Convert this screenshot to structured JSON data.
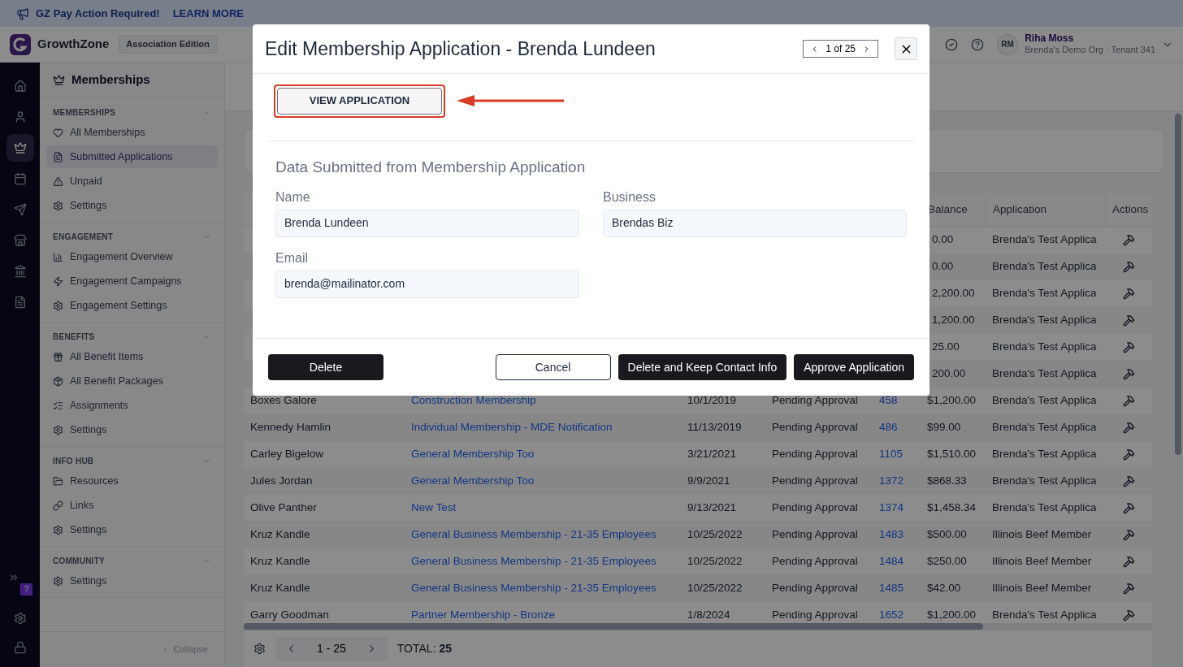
{
  "banner": {
    "message": "GZ Pay Action Required!",
    "link": "LEARN MORE"
  },
  "topbar": {
    "brand": "GrowthZone",
    "edition": "Association Edition",
    "user": {
      "initials": "RM",
      "name": "Riha Moss",
      "org": "Brenda's Demo Org · Tenant 341"
    }
  },
  "rail": {
    "items": [
      {
        "selected": false
      },
      {
        "selected": false
      },
      {
        "selected": true
      },
      {
        "selected": false
      },
      {
        "selected": false
      },
      {
        "selected": false
      },
      {
        "selected": false
      },
      {
        "selected": false
      }
    ],
    "help_badge": "?"
  },
  "sidebar": {
    "title": "Memberships",
    "sections": [
      {
        "heading": "MEMBERSHIPS",
        "items": [
          {
            "label": "All Memberships",
            "selected": false
          },
          {
            "label": "Submitted Applications",
            "selected": true
          },
          {
            "label": "Unpaid",
            "selected": false
          },
          {
            "label": "Settings",
            "selected": false
          }
        ]
      },
      {
        "heading": "ENGAGEMENT",
        "items": [
          {
            "label": "Engagement Overview",
            "selected": false
          },
          {
            "label": "Engagement Campaigns",
            "selected": false
          },
          {
            "label": "Engagement Settings",
            "selected": false
          }
        ]
      },
      {
        "heading": "BENEFITS",
        "items": [
          {
            "label": "All Benefit Items",
            "selected": false
          },
          {
            "label": "All Benefit Packages",
            "selected": false
          },
          {
            "label": "Assignments",
            "selected": false
          },
          {
            "label": "Settings",
            "selected": false
          }
        ]
      },
      {
        "heading": "INFO HUB",
        "items": [
          {
            "label": "Resources",
            "selected": false
          },
          {
            "label": "Links",
            "selected": false
          },
          {
            "label": "Settings",
            "selected": false
          }
        ]
      },
      {
        "heading": "COMMUNITY",
        "items": [
          {
            "label": "Settings",
            "selected": false
          }
        ]
      }
    ],
    "collapse": "Collapse"
  },
  "table": {
    "columns": [
      {
        "label": "Balance"
      },
      {
        "label": "Application"
      },
      {
        "label": "Actions"
      }
    ],
    "rows": [
      {
        "kind": "partial",
        "balance": "0.00",
        "application": "Brenda's Test Applica"
      },
      {
        "kind": "partial",
        "balance": "0.00",
        "application": "Brenda's Test Applica"
      },
      {
        "kind": "partial",
        "balance": "2,200.00",
        "application": "Brenda's Test Applica"
      },
      {
        "kind": "partial",
        "balance": "1,200.00",
        "application": "Brenda's Test Applica"
      },
      {
        "kind": "partial",
        "balance": "25.00",
        "application": "Brenda's Test Applica"
      },
      {
        "kind": "partial",
        "balance": "200.00",
        "application": "Brenda's Test Applica"
      },
      {
        "kind": "full",
        "name": "Boxes Galore",
        "membership": "Construction Membership",
        "date": "10/1/2019",
        "status": "Pending Approval",
        "number": "458",
        "balance": "$1,200.00",
        "application": "Brenda's Test Applica"
      },
      {
        "kind": "full",
        "name": "Kennedy Hamlin",
        "membership": "Individual Membership - MDE Notification",
        "date": "11/13/2019",
        "status": "Pending Approval",
        "number": "486",
        "balance": "$99.00",
        "application": "Brenda's Test Applica"
      },
      {
        "kind": "full",
        "name": "Carley Bigelow",
        "membership": "General Membership Too",
        "date": "3/21/2021",
        "status": "Pending Approval",
        "number": "1105",
        "balance": "$1,510.00",
        "application": "Brenda's Test Applica"
      },
      {
        "kind": "full",
        "name": "Jules Jordan",
        "membership": "General Membership Too",
        "date": "9/9/2021",
        "status": "Pending Approval",
        "number": "1372",
        "balance": "$868.33",
        "application": "Brenda's Test Applica"
      },
      {
        "kind": "full",
        "name": "Olive Panther",
        "membership": "New Test",
        "date": "9/13/2021",
        "status": "Pending Approval",
        "number": "1374",
        "balance": "$1,458.34",
        "application": "Brenda's Test Applica"
      },
      {
        "kind": "full",
        "name": "Kruz Kandle",
        "membership": "General Business Membership - 21-35 Employees",
        "date": "10/25/2022",
        "status": "Pending Approval",
        "number": "1483",
        "balance": "$500.00",
        "application": "Illinois Beef Member"
      },
      {
        "kind": "full",
        "name": "Kruz Kandle",
        "membership": "General Business Membership - 21-35 Employees",
        "date": "10/25/2022",
        "status": "Pending Approval",
        "number": "1484",
        "balance": "$250.00",
        "application": "Illinois Beef Member"
      },
      {
        "kind": "full",
        "name": "Kruz Kandle",
        "membership": "General Business Membership - 21-35 Employees",
        "date": "10/25/2022",
        "status": "Pending Approval",
        "number": "1485",
        "balance": "$42.00",
        "application": "Illinois Beef Member"
      },
      {
        "kind": "full",
        "name": "Garry Goodman",
        "membership": "Partner Membership - Bronze",
        "date": "1/8/2024",
        "status": "Pending Approval",
        "number": "1652",
        "balance": "$1,200.00",
        "application": "Brenda's Test Applica"
      }
    ]
  },
  "pagination": {
    "range": "1 - 25",
    "total_label": "TOTAL:",
    "total": "25"
  },
  "modal": {
    "title": "Edit Membership Application - Brenda Lundeen",
    "pager": "1 of 25",
    "view_button": "VIEW APPLICATION",
    "section_title": "Data Submitted from Membership Application",
    "fields": [
      {
        "label": "Name",
        "value": "Brenda Lundeen"
      },
      {
        "label": "Business",
        "value": "Brendas Biz"
      },
      {
        "label": "Email",
        "value": "brenda@mailinator.com"
      }
    ],
    "buttons": [
      {
        "label": "Delete",
        "kind": "left"
      },
      {
        "label": "Cancel",
        "kind": "outline"
      },
      {
        "label": "Delete and Keep Contact Info",
        "kind": "dark"
      },
      {
        "label": "Approve Application",
        "kind": "dark"
      }
    ]
  }
}
